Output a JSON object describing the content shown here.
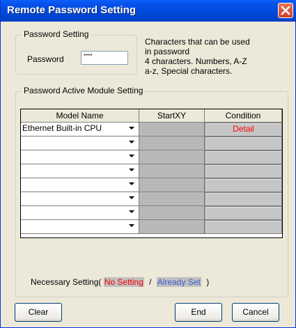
{
  "window": {
    "title": "Remote Password Setting"
  },
  "password_group": {
    "label": "Password Setting",
    "password_label": "Password",
    "password_value": "****"
  },
  "help_text": "Characters that can be used\nin password\n 4 characters. Numbers, A-Z\na-z, Special characters.",
  "module_group": {
    "label": "Password Active Module Setting",
    "columns": [
      "Model Name",
      "StartXY",
      "Condition"
    ],
    "rows": [
      {
        "model": "Ethernet Built-in CPU",
        "startxy": "",
        "condition": "Detail"
      },
      {
        "model": "",
        "startxy": "",
        "condition": ""
      },
      {
        "model": "",
        "startxy": "",
        "condition": ""
      },
      {
        "model": "",
        "startxy": "",
        "condition": ""
      },
      {
        "model": "",
        "startxy": "",
        "condition": ""
      },
      {
        "model": "",
        "startxy": "",
        "condition": ""
      },
      {
        "model": "",
        "startxy": "",
        "condition": ""
      },
      {
        "model": "",
        "startxy": "",
        "condition": ""
      }
    ]
  },
  "necessary": {
    "prefix": "Necessary Setting(",
    "no_setting": "No Setting",
    "separator": "/",
    "already_set": "Already Set",
    "suffix": ")"
  },
  "buttons": {
    "clear": "Clear",
    "end": "End",
    "cancel": "Cancel"
  },
  "colors": {
    "titlebar": "#0049d8",
    "no_setting": "#ff0000",
    "already_set": "#3b5bc8",
    "detail": "#ff0000"
  },
  "icons": {
    "close": "close-icon",
    "dropdown": "chevron-down-icon"
  }
}
